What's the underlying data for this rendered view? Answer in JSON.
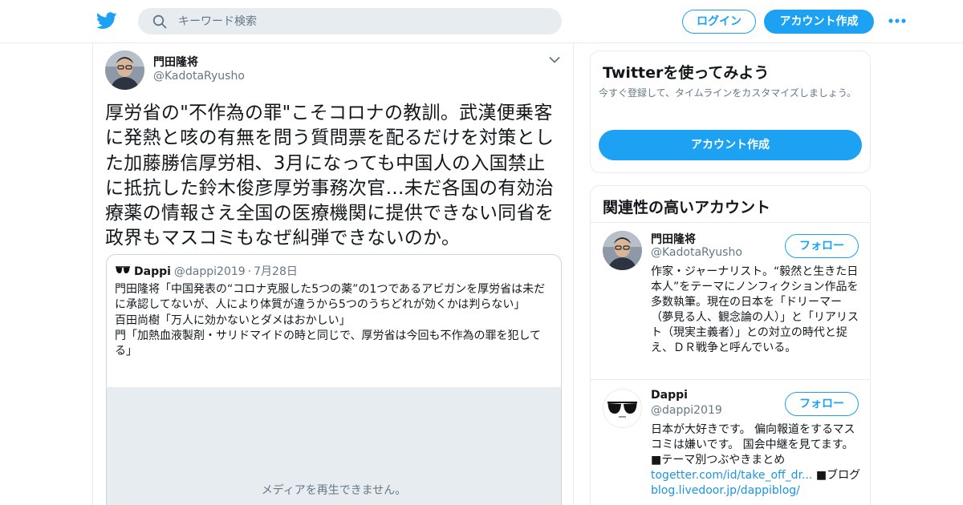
{
  "header": {
    "search_placeholder": "キーワード検索",
    "login_label": "ログイン",
    "signup_label": "アカウント作成",
    "brand_color": "#1da1f2"
  },
  "tweet": {
    "author_name": "門田隆将",
    "author_handle": "@KadotaRyusho",
    "text": "厚労省の\"不作為の罪\"こそコロナの教訓。武漢便乗客に発熱と咳の有無を問う質問票を配るだけを対策とした加藤勝信厚労相、3月になっても中国人の入国禁止に抵抗した鈴木俊彦厚労事務次官…未だ各国の有効治療薬の情報さえ全国の医療機関に提供できない同省を政界もマスコミもなぜ糾弾できないのか。",
    "quote": {
      "name": "Dappi",
      "handle": "@dappi2019",
      "separator": "·",
      "date": "7月28日",
      "lines": [
        "門田隆将「中国発表の“コロナ克服した5つの薬”の1つであるアビガンを厚労省は未だに承認してないが、人により体質が違うから5つのうちどれが効くかは判らない」",
        "百田尚樹「万人に効かないとダメはおかしい」",
        "門「加熱血液製剤・サリドマイドの時と同じで、厚労省は今回も不作為の罪を犯してる」"
      ],
      "media_message": "メディアを再生できません。"
    }
  },
  "sidebar": {
    "try_card": {
      "title": "Twitterを使ってみよう",
      "description": "今すぐ登録して、タイムラインをカスタマイズしましょう。",
      "button_label": "アカウント作成"
    },
    "related": {
      "title": "関連性の高いアカウント",
      "follow_label": "フォロー",
      "accounts": [
        {
          "name": "門田隆将",
          "handle": "@KadotaRyusho",
          "bio": "作家・ジャーナリスト。“毅然と生きた日本人”をテーマにノンフィクション作品を多数執筆。現在の日本を「ドリーマー（夢見る人、観念論の人）」と「リアリスト（現実主義者）」との対立の時代と捉え、ＤＲ戦争と呼んでいる。"
        },
        {
          "name": "Dappi",
          "handle": "@dappi2019",
          "bio_text": "日本が大好きです。 偏向報道をするマスコミは嫌いです。 国会中継を見てます。 ■テーマ別つぶやきまとめ",
          "bio_link1": "togetter.com/id/take_off_dr...",
          "bio_mid": "■ブログ",
          "bio_link2": "blog.livedoor.jp/dappiblog/"
        }
      ]
    }
  }
}
